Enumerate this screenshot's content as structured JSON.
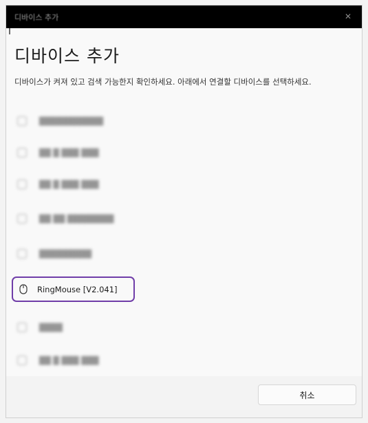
{
  "window": {
    "title": "디바이스 추가",
    "close_glyph": "✕"
  },
  "heading": "디바이스 추가",
  "description": "디바이스가 켜져 있고 검색 가능한지 확인하세요. 아래에서 연결할 디바이스를 선택하세요.",
  "devices": [
    {
      "label": "███████████",
      "icon": "generic-device-icon",
      "blurred": true
    },
    {
      "label": "██ █ ███ ███",
      "icon": "generic-device-icon",
      "blurred": true
    },
    {
      "label": "██ █ ███ ███",
      "icon": "generic-device-icon",
      "blurred": true
    },
    {
      "label": "██ ██ ████████",
      "icon": "generic-device-icon",
      "blurred": true
    },
    {
      "label": "█████████",
      "icon": "generic-device-icon",
      "blurred": true
    },
    {
      "label": "RingMouse [V2.041]",
      "icon": "mouse-icon",
      "blurred": false,
      "selected": true
    },
    {
      "label": "████",
      "icon": "generic-device-icon",
      "blurred": true
    },
    {
      "label": "██ █ ███ ███",
      "icon": "generic-device-icon",
      "blurred": true
    }
  ],
  "footer": {
    "cancel_label": "취소"
  },
  "colors": {
    "selection_border": "#6f3ca8",
    "titlebar": "#000000",
    "background": "#f9f9f9"
  }
}
